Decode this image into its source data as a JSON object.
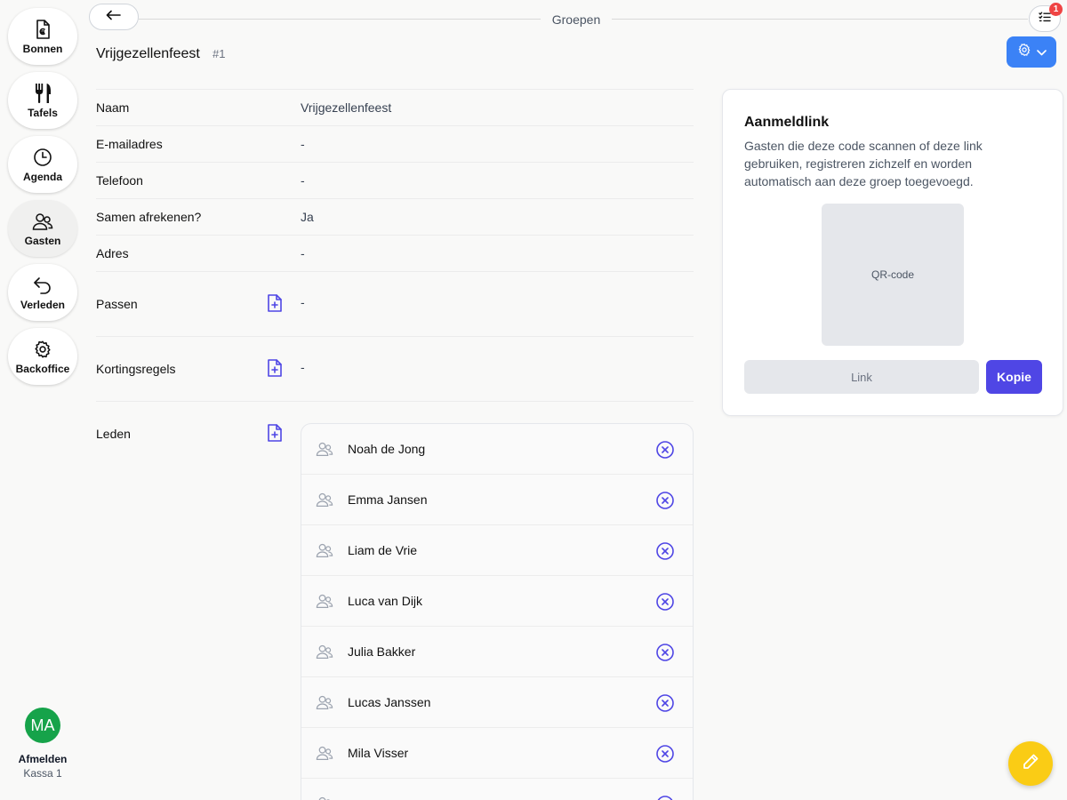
{
  "sidebar": {
    "items": [
      {
        "label": "Bonnen",
        "icon": "receipt-euro-icon"
      },
      {
        "label": "Tafels",
        "icon": "utensils-icon"
      },
      {
        "label": "Agenda",
        "icon": "clock-icon"
      },
      {
        "label": "Gasten",
        "icon": "users-icon",
        "active": true
      },
      {
        "label": "Verleden",
        "icon": "undo-arrow-icon"
      },
      {
        "label": "Backoffice",
        "icon": "gear-icon"
      }
    ],
    "user": {
      "initials": "MA",
      "logout_label": "Afmelden",
      "register": "Kassa 1",
      "avatar_color": "#16a34a"
    }
  },
  "header": {
    "title": "Groepen",
    "notification_count": "1"
  },
  "group": {
    "name": "Vrijgezellenfeest",
    "id": "#1"
  },
  "details": [
    {
      "label": "Naam",
      "value": "Vrijgezellenfeest"
    },
    {
      "label": "E-mailadres",
      "value": "-"
    },
    {
      "label": "Telefoon",
      "value": "-"
    },
    {
      "label": "Samen afrekenen?",
      "value": "Ja"
    },
    {
      "label": "Adres",
      "value": "-"
    },
    {
      "label": "Passen",
      "value": "-"
    },
    {
      "label": "Kortingsregels",
      "value": "-"
    }
  ],
  "members_section": {
    "label": "Leden",
    "members": [
      "Noah de Jong",
      "Emma Jansen",
      "Liam de Vrie",
      "Luca van Dijk",
      "Julia Bakker",
      "Lucas Janssen",
      "Mila Visser"
    ]
  },
  "signup_card": {
    "title": "Aanmeldlink",
    "description": "Gasten die deze code scannen of deze link gebruiken, registreren zichzelf en worden automatisch aan deze groep toegevoegd.",
    "qr_placeholder": "QR-code",
    "link_placeholder": "Link",
    "copy_label": "Kopie"
  },
  "colors": {
    "accent": "#4f46e5",
    "settings_button": "#3b82f6",
    "fab": "#facc15",
    "badge": "#ef4444"
  }
}
